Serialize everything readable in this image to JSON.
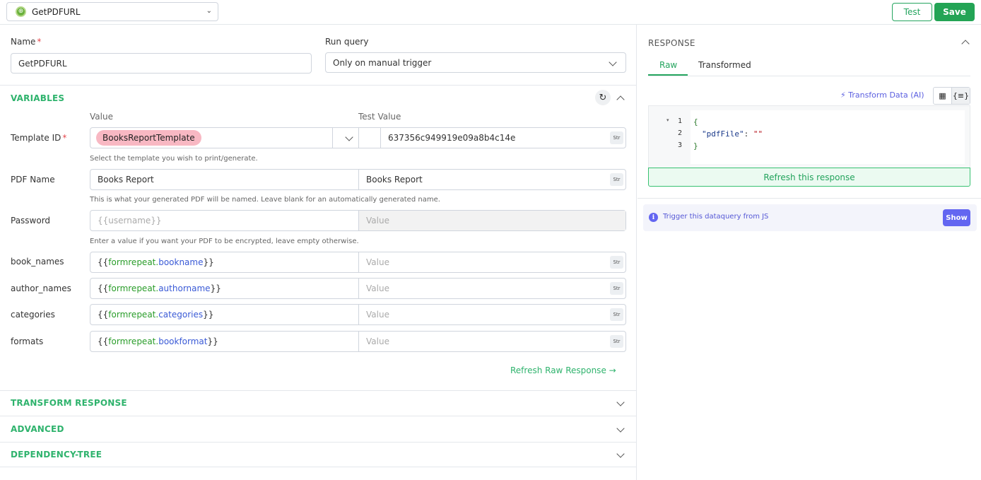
{
  "header": {
    "query_name": "GetPDFURL",
    "test_label": "Test",
    "save_label": "Save"
  },
  "form": {
    "name_label": "Name",
    "name_value": "GetPDFURL",
    "run_query_label": "Run query",
    "run_query_value": "Only on manual trigger"
  },
  "variables": {
    "title": "VARIABLES",
    "col_value": "Value",
    "col_test_value": "Test Value",
    "template": {
      "label": "Template ID",
      "value": "BooksReportTemplate",
      "test_value": "637356c949919e09a8b4c14e",
      "hint": "Select the template you wish to print/generate."
    },
    "pdf_name": {
      "label": "PDF Name",
      "value": "Books Report",
      "test_value": "Books Report",
      "hint": "This is what your generated PDF will be named. Leave blank for an automatically generated name."
    },
    "password": {
      "label": "Password",
      "placeholder": "{{username}}",
      "test_placeholder": "Value",
      "hint": "Enter a value if you want your PDF to be encrypted, leave empty otherwise."
    },
    "rows": [
      {
        "label": "book_names",
        "open": "{{",
        "obj": "formrepeat",
        "dot": ".",
        "prop": "bookname",
        "close": "}}",
        "test_placeholder": "Value"
      },
      {
        "label": "author_names",
        "open": "{{",
        "obj": "formrepeat",
        "dot": ".",
        "prop": "authorname",
        "close": "}}",
        "test_placeholder": "Value"
      },
      {
        "label": "categories",
        "open": "{{",
        "obj": "formrepeat",
        "dot": ".",
        "prop": "categories",
        "close": "}}",
        "test_placeholder": "Value"
      },
      {
        "label": "formats",
        "open": "{{",
        "obj": "formrepeat",
        "dot": ".",
        "prop": "bookformat",
        "close": "}}",
        "test_placeholder": "Value"
      }
    ],
    "str_badge": "Str",
    "refresh_raw": "Refresh Raw Response →"
  },
  "sections": {
    "transform": "TRANSFORM RESPONSE",
    "advanced": "ADVANCED",
    "dependency": "DEPENDENCY-TREE"
  },
  "response": {
    "title": "RESPONSE",
    "tab_raw": "Raw",
    "tab_transformed": "Transformed",
    "transform_ai": "Transform Data (AI)",
    "lines": [
      "1",
      "2",
      "3"
    ],
    "code_open": "{",
    "code_key": "\"pdfFile\"",
    "code_colon": ": ",
    "code_value": "\"\"",
    "code_close": "}",
    "refresh_label": "Refresh this response",
    "trigger_text": "Trigger this dataquery from JS",
    "show_label": "Show"
  },
  "colors": {
    "brand_green": "#25a55f",
    "accent_indigo": "#6366f1",
    "pill_pink": "#f8b8c3"
  }
}
